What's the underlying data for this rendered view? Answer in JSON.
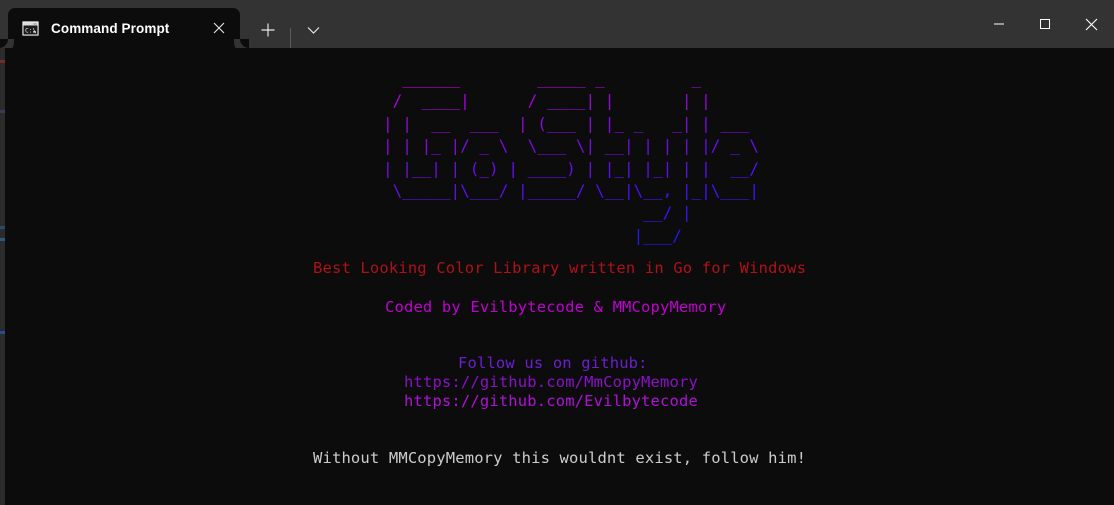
{
  "window": {
    "app": "windows-terminal",
    "background": "#0c0c0c",
    "titlebar_background": "#333333"
  },
  "titlebar": {
    "tab": {
      "title": "Command Prompt",
      "icon": "command-prompt-icon",
      "close_label": "✕"
    },
    "new_tab_label": "+",
    "dropdown_label": "⌄",
    "minimize_label": "‒",
    "maximize_label": "□",
    "close_label": "✕"
  },
  "terminal": {
    "ascii_art": {
      "lines": [
        "  ______        _____ _         _      ",
        " /  ____|      / ____| |       | |     ",
        "| |  __  ___  | (___ | |_ _   _| | ___ ",
        "| | |_ |/ _ \\  \\___ \\| __| | | | |/ _ \\",
        "| |__| | (_) | ____) | |_| |_| | |  __/",
        " \\_____|\\___/ |_____/ \\__|\\__, |_|\\___|",
        "                           __/ |       ",
        "                          |___/        "
      ],
      "gradient_start": "#c000d0",
      "gradient_end": "#1a1aff"
    },
    "messages": {
      "tagline": "Best Looking Color Library written in Go for Windows",
      "tagline_color": "#b01018",
      "credits": "Coded by Evilbytecode & MMCopyMemory",
      "credits_color": "#c000d0",
      "follow_heading": "Follow us on github:",
      "follow_heading_color": "#6a1fd0",
      "url_1": "https://github.com/MmCopyMemory",
      "url_1_color": "#8a10c8",
      "url_2": "https://github.com/Evilbytecode",
      "url_2_color": "#b010d8",
      "thanks": "Without MMCopyMemory this wouldnt exist, follow him!",
      "thanks_color": "#cccccc"
    }
  }
}
